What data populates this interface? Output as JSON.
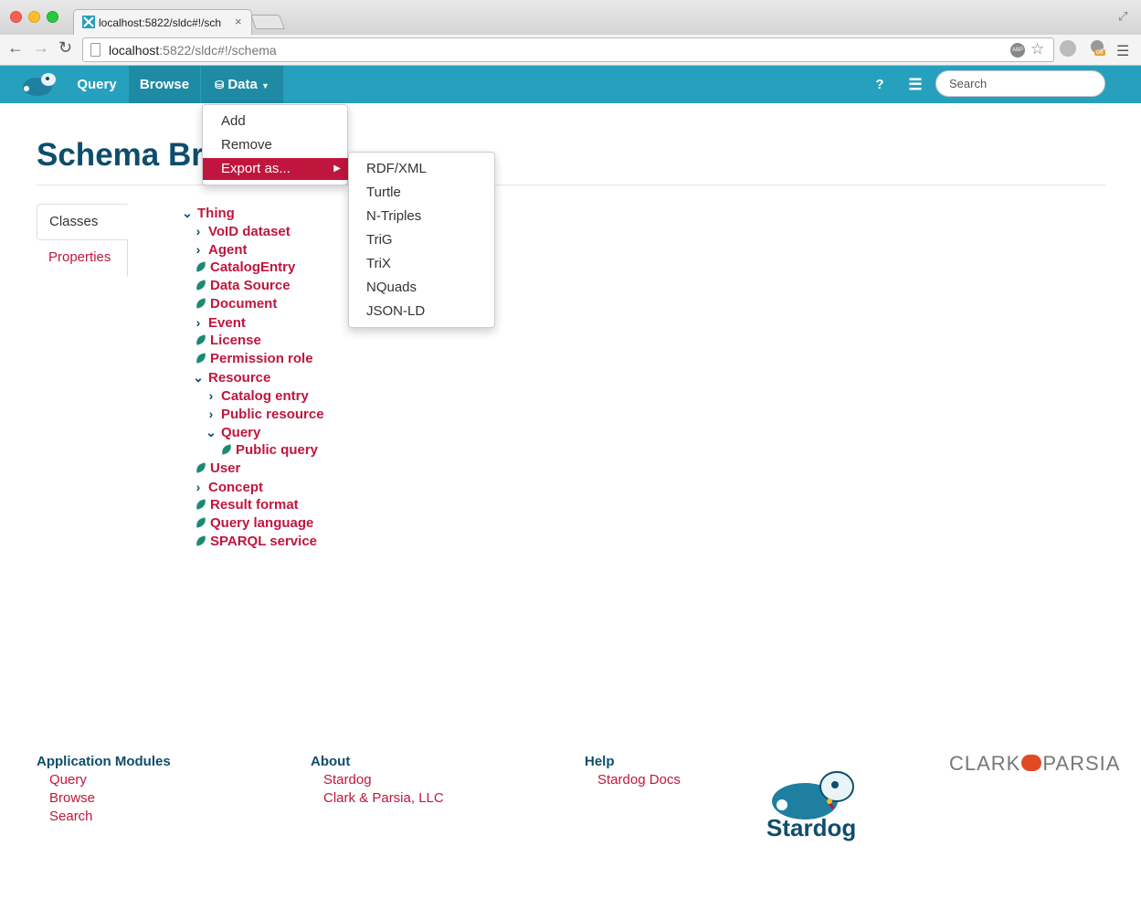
{
  "browser": {
    "tab_title": "localhost:5822/sldc#!/sch",
    "url_host": "localhost",
    "url_rest": ":5822/sldc#!/schema",
    "extension_badge": "off",
    "abp_label": "ABP"
  },
  "nav": {
    "query": "Query",
    "browse": "Browse",
    "data": "Data",
    "help": "?",
    "search_placeholder": "Search"
  },
  "page": {
    "title": "Schema Browser"
  },
  "side_tabs": [
    "Classes",
    "Properties"
  ],
  "tree": [
    {
      "label": "Thing",
      "icon": "chevron-down-icon"
    },
    {
      "label": "VoID dataset",
      "icon": "chevron-right-icon"
    },
    {
      "label": "Agent",
      "icon": "chevron-right-icon"
    },
    {
      "label": "CatalogEntry",
      "icon": "leaf-icon"
    },
    {
      "label": "Data Source",
      "icon": "leaf-icon"
    },
    {
      "label": "Document",
      "icon": "leaf-icon"
    },
    {
      "label": "Event",
      "icon": "chevron-right-icon"
    },
    {
      "label": "License",
      "icon": "leaf-icon"
    },
    {
      "label": "Permission role",
      "icon": "leaf-icon"
    },
    {
      "label": "Resource",
      "icon": "chevron-down-icon"
    },
    {
      "label": "Catalog entry",
      "icon": "chevron-right-icon"
    },
    {
      "label": "Public resource",
      "icon": "chevron-right-icon"
    },
    {
      "label": "Query",
      "icon": "chevron-down-icon"
    },
    {
      "label": "Public query",
      "icon": "leaf-icon"
    },
    {
      "label": "User",
      "icon": "leaf-icon"
    },
    {
      "label": "Concept",
      "icon": "chevron-right-icon"
    },
    {
      "label": "Result format",
      "icon": "leaf-icon"
    },
    {
      "label": "Query language",
      "icon": "leaf-icon"
    },
    {
      "label": "SPARQL service",
      "icon": "leaf-icon"
    }
  ],
  "data_menu": {
    "items": [
      "Add",
      "Remove",
      "Export as..."
    ],
    "active": "Export as..."
  },
  "export_menu": [
    "RDF/XML",
    "Turtle",
    "N-Triples",
    "TriG",
    "TriX",
    "NQuads",
    "JSON-LD"
  ],
  "footer": {
    "app_modules": {
      "heading": "Application Modules",
      "links": [
        "Query",
        "Browse",
        "Search"
      ]
    },
    "about": {
      "heading": "About",
      "links": [
        "Stardog",
        "Clark & Parsia, LLC"
      ]
    },
    "help": {
      "heading": "Help",
      "links": [
        "Stardog Docs"
      ]
    },
    "stardog_wordmark": "Stardog",
    "cp_left": "CLARK",
    "cp_right": "PARSIA"
  },
  "colors": {
    "navbar": "#27a0bd",
    "accent": "#c0163e",
    "heading": "#0e4d6c"
  }
}
